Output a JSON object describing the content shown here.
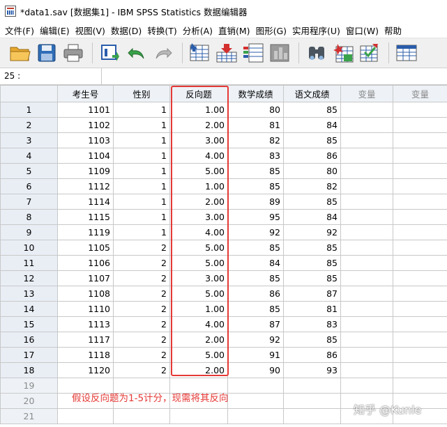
{
  "window": {
    "title": "*data1.sav [数据集1] - IBM SPSS Statistics 数据编辑器"
  },
  "menu": [
    "文件(F)",
    "编辑(E)",
    "视图(V)",
    "数据(D)",
    "转换(T)",
    "分析(A)",
    "直销(M)",
    "图形(G)",
    "实用程序(U)",
    "窗口(W)",
    "帮助"
  ],
  "toolbar": [
    "open-icon",
    "save-icon",
    "print-icon",
    "dialog-recall-icon",
    "undo-icon",
    "redo-icon",
    "goto-case-icon",
    "goto-variable-icon",
    "variables-icon",
    "run-descriptives-icon",
    "find-icon",
    "insert-cases-icon",
    "insert-variable-icon",
    "split-file-icon"
  ],
  "cell_ref": "25 :",
  "columns": [
    "考生号",
    "性别",
    "反向题",
    "数学成绩",
    "语文成绩",
    "变量",
    "变量"
  ],
  "rows": [
    {
      "n": "1",
      "cells": [
        "1101",
        "1",
        "1.00",
        "80",
        "85"
      ]
    },
    {
      "n": "2",
      "cells": [
        "1102",
        "1",
        "2.00",
        "81",
        "84"
      ]
    },
    {
      "n": "3",
      "cells": [
        "1103",
        "1",
        "3.00",
        "82",
        "85"
      ]
    },
    {
      "n": "4",
      "cells": [
        "1104",
        "1",
        "4.00",
        "83",
        "86"
      ]
    },
    {
      "n": "5",
      "cells": [
        "1109",
        "1",
        "5.00",
        "85",
        "80"
      ]
    },
    {
      "n": "6",
      "cells": [
        "1112",
        "1",
        "1.00",
        "85",
        "82"
      ]
    },
    {
      "n": "7",
      "cells": [
        "1114",
        "1",
        "2.00",
        "89",
        "85"
      ]
    },
    {
      "n": "8",
      "cells": [
        "1115",
        "1",
        "3.00",
        "95",
        "84"
      ]
    },
    {
      "n": "9",
      "cells": [
        "1119",
        "1",
        "4.00",
        "92",
        "92"
      ]
    },
    {
      "n": "10",
      "cells": [
        "1105",
        "2",
        "5.00",
        "85",
        "85"
      ]
    },
    {
      "n": "11",
      "cells": [
        "1106",
        "2",
        "5.00",
        "84",
        "85"
      ]
    },
    {
      "n": "12",
      "cells": [
        "1107",
        "2",
        "3.00",
        "85",
        "85"
      ]
    },
    {
      "n": "13",
      "cells": [
        "1108",
        "2",
        "5.00",
        "86",
        "87"
      ]
    },
    {
      "n": "14",
      "cells": [
        "1110",
        "2",
        "1.00",
        "85",
        "81"
      ]
    },
    {
      "n": "15",
      "cells": [
        "1113",
        "2",
        "4.00",
        "87",
        "83"
      ]
    },
    {
      "n": "16",
      "cells": [
        "1117",
        "2",
        "2.00",
        "92",
        "85"
      ]
    },
    {
      "n": "17",
      "cells": [
        "1118",
        "2",
        "5.00",
        "91",
        "86"
      ]
    },
    {
      "n": "18",
      "cells": [
        "1120",
        "2",
        "2.00",
        "90",
        "93"
      ]
    },
    {
      "n": "19",
      "cells": []
    },
    {
      "n": "20",
      "cells": []
    },
    {
      "n": "21",
      "cells": []
    }
  ],
  "annotation": "假设反向题为1-5计分，现需将其反向",
  "watermark": "知乎 @Kunle",
  "colors": {
    "highlight": "#e53935",
    "header_bg": "#eef2f7",
    "gridline": "#c8c8c8"
  }
}
